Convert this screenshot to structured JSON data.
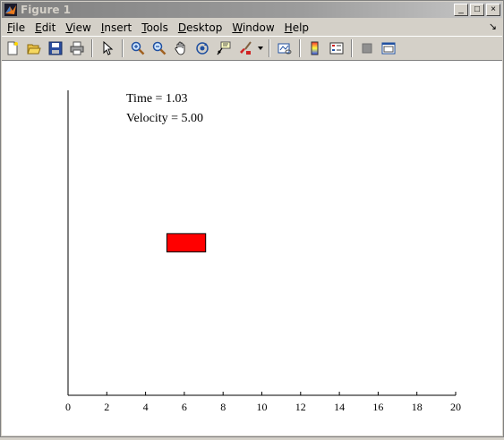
{
  "window": {
    "title": "Figure 1"
  },
  "title_controls": {
    "minimize": "_",
    "maximize": "□",
    "close": "×"
  },
  "menu": [
    {
      "accel": "F",
      "rest": "ile"
    },
    {
      "accel": "E",
      "rest": "dit"
    },
    {
      "accel": "V",
      "rest": "iew"
    },
    {
      "accel": "I",
      "rest": "nsert"
    },
    {
      "accel": "T",
      "rest": "ools"
    },
    {
      "accel": "D",
      "rest": "esktop"
    },
    {
      "accel": "W",
      "rest": "indow"
    },
    {
      "accel": "H",
      "rest": "elp"
    }
  ],
  "menu_dock_arrow": "↘",
  "toolbar_icons": [
    "new-figure-icon",
    "open-file-icon",
    "save-icon",
    "print-icon",
    "edit-plot-arrow-icon",
    "zoom-in-icon",
    "zoom-out-icon",
    "pan-hand-icon",
    "rotate-3d-icon",
    "data-cursor-icon",
    "brush-icon",
    "link-plot-icon",
    "colorbar-icon",
    "legend-icon",
    "hide-plot-tools-icon",
    "show-plot-tools-icon"
  ],
  "figure": {
    "annotations": {
      "time": "Time = 1.03",
      "velocity": "Velocity = 5.00"
    },
    "x_ticks": [
      "0",
      "2",
      "4",
      "6",
      "8",
      "10",
      "12",
      "14",
      "16",
      "18",
      "20"
    ],
    "xlim": [
      0,
      20
    ],
    "ylim": [
      0,
      1
    ],
    "block": {
      "x_start": 5.1,
      "x_end": 7.1,
      "y_bottom": 0.47,
      "y_top": 0.53,
      "fill": "#ff0000"
    },
    "axis_color": "#000000"
  }
}
